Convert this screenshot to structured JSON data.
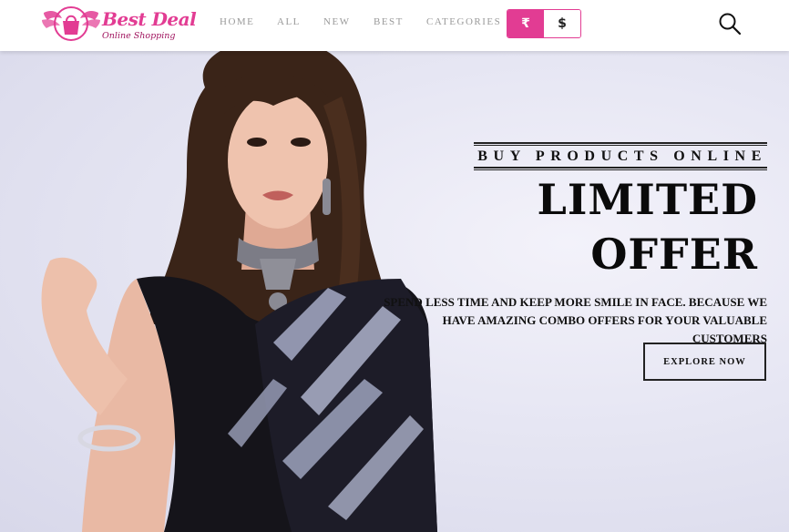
{
  "header": {
    "brand": {
      "title": "Best Deal",
      "subtitle": "Online Shopping"
    },
    "nav": [
      {
        "id": "home",
        "label": "HOME"
      },
      {
        "id": "all",
        "label": "ALL"
      },
      {
        "id": "new",
        "label": "NEW"
      },
      {
        "id": "best",
        "label": "BEST"
      },
      {
        "id": "categories",
        "label": "CATEGORIES"
      }
    ],
    "currency": {
      "options": [
        "₹",
        "$"
      ],
      "selected": "₹"
    },
    "search_icon": "search-icon"
  },
  "hero": {
    "kicker": "BUY PRODUCTS ONLINE",
    "headline_line1": "LIMITED",
    "headline_line2": "OFFER",
    "description": "Spend less time and keep more smile in face. Because we have amazing combo offers for your valuable customers",
    "cta_label": "EXPLORE NOW"
  },
  "colors": {
    "brand_pink": "#e23c93",
    "text_dark": "#111111",
    "nav_gray": "#9a9a9a",
    "hero_bg": "#e6e6f3"
  }
}
